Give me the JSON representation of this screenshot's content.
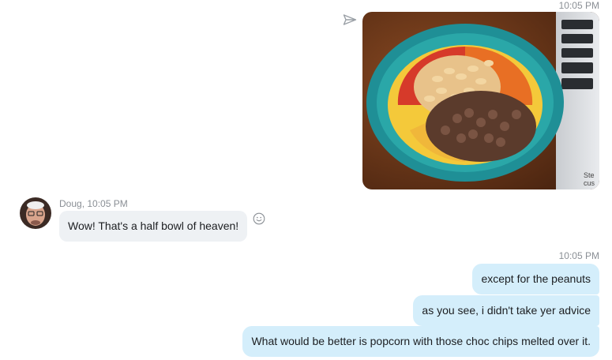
{
  "messages": {
    "photo_timestamp": "10:05 PM",
    "incoming": {
      "meta": "Doug, 10:05 PM",
      "text": "Wow! That's a half bowl of heaven!"
    },
    "outgoing_timestamp": "10:05 PM",
    "outgoing": [
      {
        "text": "except for the peanuts"
      },
      {
        "text": "as you see, i didn't take yer advice"
      },
      {
        "text": "What would be better is popcorn with those choc chips melted over it."
      }
    ]
  },
  "icons": {
    "send": "send-icon",
    "emoji": "smiley-icon"
  },
  "colors": {
    "outgoing_bubble": "#d4eefb",
    "incoming_bubble": "#eef1f4",
    "timestamp": "#8a8f95"
  }
}
